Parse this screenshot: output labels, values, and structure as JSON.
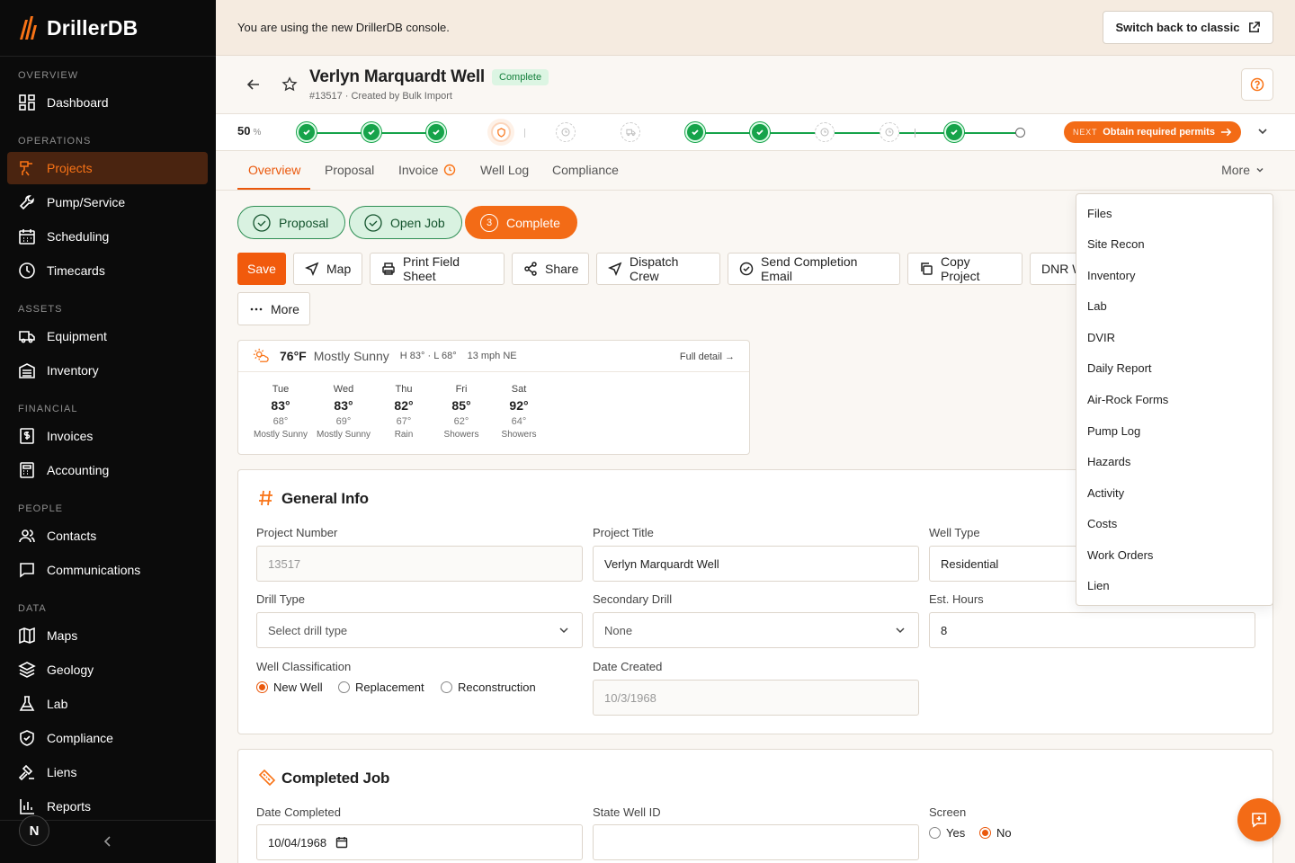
{
  "app": {
    "name": "DrillerDB",
    "brand_color": "#f97316"
  },
  "sidebar": {
    "sections": {
      "overview": "OVERVIEW",
      "operations": "OPERATIONS",
      "assets": "ASSETS",
      "financial": "FINANCIAL",
      "people": "PEOPLE",
      "data": "DATA"
    },
    "items": {
      "dashboard": "Dashboard",
      "projects": "Projects",
      "pump_service": "Pump/Service",
      "scheduling": "Scheduling",
      "timecards": "Timecards",
      "equipment": "Equipment",
      "inventory": "Inventory",
      "invoices": "Invoices",
      "accounting": "Accounting",
      "contacts": "Contacts",
      "communications": "Communications",
      "maps": "Maps",
      "geology": "Geology",
      "lab": "Lab",
      "compliance": "Compliance",
      "liens": "Liens",
      "reports": "Reports"
    },
    "active": "Projects",
    "user_initial": "N"
  },
  "banner": {
    "message": "You are using the new DrillerDB console.",
    "switch_label": "Switch back to classic"
  },
  "project": {
    "title": "Verlyn Marquardt Well",
    "status": "Complete",
    "subtitle": "#13517 · Created by Bulk Import"
  },
  "progress": {
    "percent": "50",
    "unit": "%",
    "completed_fraction": 0.5,
    "next_prefix": "NEXT",
    "next_label": "Obtain required permits"
  },
  "tabs": {
    "overview": "Overview",
    "proposal": "Proposal",
    "invoice": "Invoice",
    "well_log": "Well Log",
    "compliance": "Compliance",
    "more": "More",
    "active": "Overview"
  },
  "stage_pills": {
    "proposal": "Proposal",
    "open_job": "Open Job",
    "complete_number": "3",
    "complete": "Complete"
  },
  "actions": {
    "save": "Save",
    "map": "Map",
    "print": "Print Field Sheet",
    "share": "Share",
    "dispatch": "Dispatch Crew",
    "completion_email": "Send Completion Email",
    "copy": "Copy Project",
    "dnr": "DNR W",
    "more": "More"
  },
  "weather": {
    "temp": "76°F",
    "condition": "Mostly Sunny",
    "hilo": "H 83° · L 68°",
    "wind": "13 mph NE",
    "detail_link": "Full detail →",
    "forecast": [
      {
        "day": "Tue",
        "hi": "83°",
        "lo": "68°",
        "cond": "Mostly Sunny"
      },
      {
        "day": "Wed",
        "hi": "83°",
        "lo": "69°",
        "cond": "Mostly Sunny"
      },
      {
        "day": "Thu",
        "hi": "82°",
        "lo": "67°",
        "cond": "Rain"
      },
      {
        "day": "Fri",
        "hi": "85°",
        "lo": "62°",
        "cond": "Showers"
      },
      {
        "day": "Sat",
        "hi": "92°",
        "lo": "64°",
        "cond": "Showers"
      }
    ]
  },
  "general_info": {
    "title": "General Info",
    "project_number_label": "Project Number",
    "project_number": "13517",
    "project_title_label": "Project Title",
    "project_title": "Verlyn Marquardt Well",
    "well_type_label": "Well Type",
    "well_type": "Residential",
    "drill_type_label": "Drill Type",
    "drill_type_placeholder": "Select drill type",
    "secondary_drill_label": "Secondary Drill",
    "secondary_drill": "None",
    "est_hours_label": "Est. Hours",
    "est_hours": "8",
    "classification_label": "Well Classification",
    "classification_options": [
      "New Well",
      "Replacement",
      "Reconstruction"
    ],
    "classification_selected": "New Well",
    "date_created_label": "Date Created",
    "date_created": "10/3/1968"
  },
  "completed_job": {
    "title": "Completed Job",
    "date_completed_label": "Date Completed",
    "date_completed": "10/04/1968",
    "state_well_id_label": "State Well ID",
    "state_well_id": "",
    "screen_label": "Screen",
    "screen_yes": "Yes",
    "screen_no": "No",
    "screen_selected": "No"
  },
  "more_menu": [
    "Files",
    "Site Recon",
    "Inventory",
    "Lab",
    "DVIR",
    "Daily Report",
    "Air-Rock Forms",
    "Pump Log",
    "Hazards",
    "Activity",
    "Costs",
    "Work Orders",
    "Lien"
  ]
}
